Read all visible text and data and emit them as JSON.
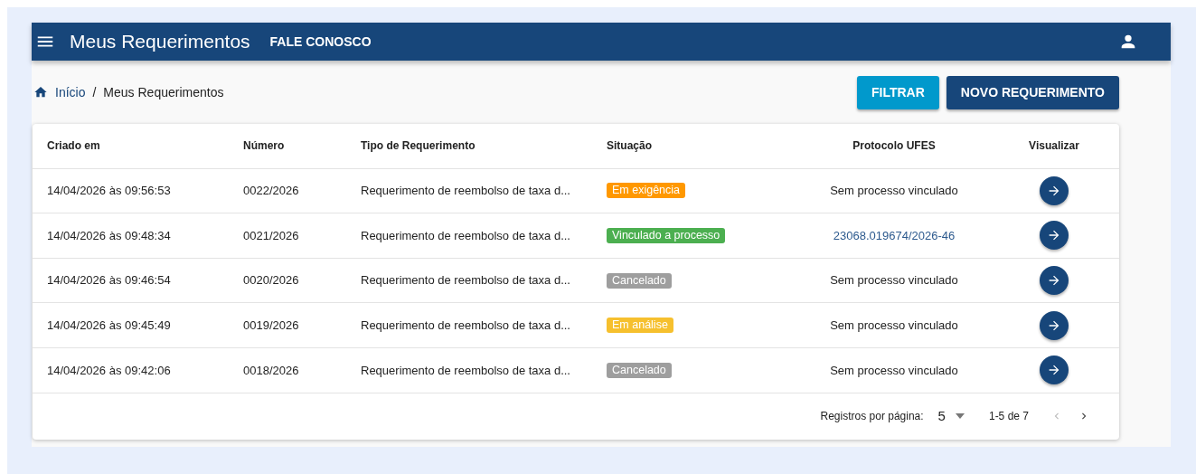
{
  "app_bar": {
    "title": "Meus Requerimentos",
    "link": "FALE CONOSCO"
  },
  "breadcrumb": [
    {
      "label": "Início",
      "kind": "link"
    },
    {
      "label": "Meus Requerimentos",
      "kind": "current",
      "separator": "/"
    }
  ],
  "buttons": [
    {
      "label": "FILTRAR",
      "kind": "secondary"
    },
    {
      "label": "NOVO REQUERIMENTO",
      "kind": "primary"
    }
  ],
  "table": {
    "columns": [
      "Criado em",
      "Número",
      "Tipo de Requerimento",
      "Situação",
      "Protocolo UFES",
      "Visualizar"
    ],
    "rows": [
      {
        "created": "14/04/2026 às 09:56:53",
        "number": "0022/2026",
        "type": "Requerimento de reembolso de taxa d...",
        "status": {
          "label": "Em exigência",
          "color": "#ff9800"
        },
        "protocol": {
          "text": "Sem processo vinculado",
          "kind": "text"
        }
      },
      {
        "created": "14/04/2026 às 09:48:34",
        "number": "0021/2026",
        "type": "Requerimento de reembolso de taxa d...",
        "status": {
          "label": "Vinculado a processo",
          "color": "#4caf50"
        },
        "protocol": {
          "text": "23068.019674/2026-46",
          "kind": "link"
        }
      },
      {
        "created": "14/04/2026 às 09:46:54",
        "number": "0020/2026",
        "type": "Requerimento de reembolso de taxa d...",
        "status": {
          "label": "Cancelado",
          "color": "#9e9e9e"
        },
        "protocol": {
          "text": "Sem processo vinculado",
          "kind": "text"
        }
      },
      {
        "created": "14/04/2026 às 09:45:49",
        "number": "0019/2026",
        "type": "Requerimento de reembolso de taxa d...",
        "status": {
          "label": "Em análise",
          "color": "#f6c02e"
        },
        "protocol": {
          "text": "Sem processo vinculado",
          "kind": "text"
        }
      },
      {
        "created": "14/04/2026 às 09:42:06",
        "number": "0018/2026",
        "type": "Requerimento de reembolso de taxa d...",
        "status": {
          "label": "Cancelado",
          "color": "#9e9e9e"
        },
        "protocol": {
          "text": "Sem processo vinculado",
          "kind": "text"
        }
      }
    ]
  },
  "pagination": {
    "label": "Registros por página:",
    "per_page": "5",
    "range": "1-5 de 7",
    "prev_disabled": true,
    "next_disabled": false
  }
}
